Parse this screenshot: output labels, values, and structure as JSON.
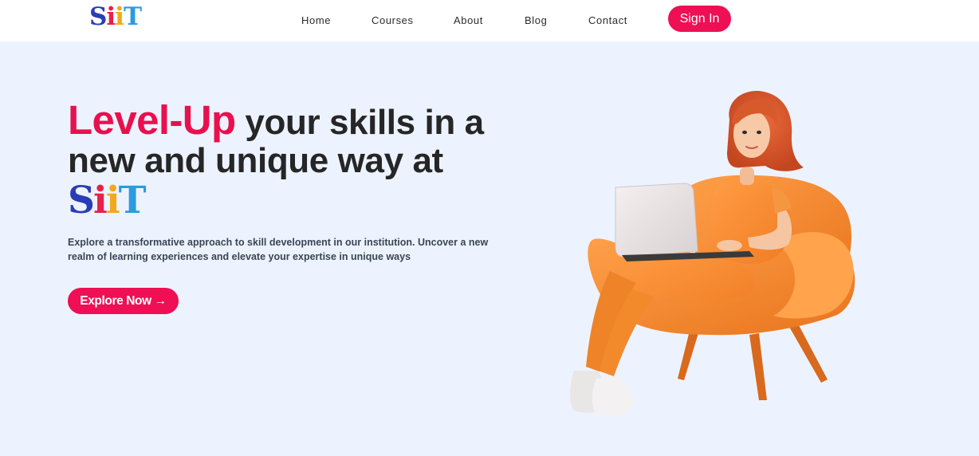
{
  "nav": {
    "logo": {
      "s": "S",
      "i1": "i",
      "i2": "i",
      "t": "T"
    },
    "links": [
      "Home",
      "Courses",
      "About",
      "Blog",
      "Contact"
    ],
    "signin_label": "Sign In"
  },
  "hero": {
    "title_accent": "Level-Up",
    "title_rest": " your skills in a new and unique way at",
    "title_logo": {
      "s": "S",
      "i1": "i",
      "i2": "i",
      "t": "T"
    },
    "description": "Explore a transformative approach to skill development in our institution. Uncover a new realm of learning experiences and elevate your expertise in unique ways",
    "cta_label": "Explore Now →"
  },
  "colors": {
    "accent": "#ee0f55",
    "background": "#edf3fe",
    "logo_s": "#2a3db4",
    "logo_i1": "#e8204a",
    "logo_i2": "#f2a81d",
    "logo_t": "#2b9be0",
    "chair": "#f58a24"
  },
  "icons": {
    "illustration": "woman-with-laptop-on-armchair-illustration"
  }
}
